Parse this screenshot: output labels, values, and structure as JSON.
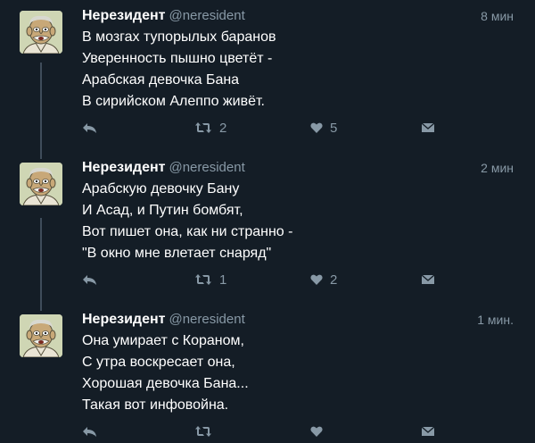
{
  "tweets": [
    {
      "author": {
        "name": "Нерезидент",
        "handle": "@neresident"
      },
      "time": "8 мин",
      "lines": [
        "В мозгах тупорылых баранов",
        "Уверенность пышно цветёт -",
        "Арабская девочка Бана",
        "В сирийском Алеппо живёт."
      ],
      "retweets": "2",
      "likes": "5"
    },
    {
      "author": {
        "name": "Нерезидент",
        "handle": "@neresident"
      },
      "time": "2 мин",
      "lines": [
        "Арабскую девочку Бану",
        "И Асад, и Путин бомбят,",
        "Вот пишет она, как ни странно -",
        "\"В окно мне влетает снаряд\""
      ],
      "retweets": "1",
      "likes": "2"
    },
    {
      "author": {
        "name": "Нерезидент",
        "handle": "@neresident"
      },
      "time": "1 мин.",
      "lines": [
        "Она умирает с Кораном,",
        "С утра воскресает она,",
        "Хорошая девочка Бана...",
        "Такая вот инфовойна."
      ],
      "retweets": "",
      "likes": ""
    }
  ],
  "icons": {
    "reply": "reply-icon",
    "retweet": "retweet-icon",
    "like": "heart-icon",
    "message": "direct-message-icon",
    "avatar": "cartoon-man-avatar"
  },
  "colors": {
    "background": "#141d26",
    "text": "#ffffff",
    "secondary": "#8899a6",
    "thread_line": "#3f4c5a"
  }
}
